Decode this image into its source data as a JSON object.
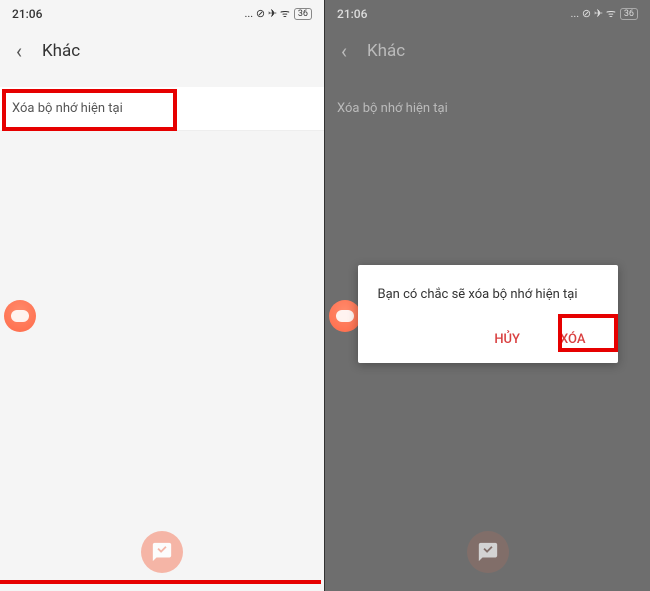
{
  "left": {
    "status": {
      "time": "21:06",
      "icons": "... ⊘ ✈ ᯤ",
      "battery": "36"
    },
    "header": {
      "title": "Khác"
    },
    "item": {
      "label": "Xóa bộ nhớ hiện tại"
    }
  },
  "right": {
    "status": {
      "time": "21:06",
      "icons": "... ⊘ ✈ ᯤ",
      "battery": "36"
    },
    "header": {
      "title": "Khác"
    },
    "item": {
      "label": "Xóa bộ nhớ hiện tại"
    },
    "dialog": {
      "message": "Bạn có chắc sẽ xóa bộ nhớ hiện tại",
      "cancel": "HỦY",
      "confirm": "XÓA"
    }
  }
}
